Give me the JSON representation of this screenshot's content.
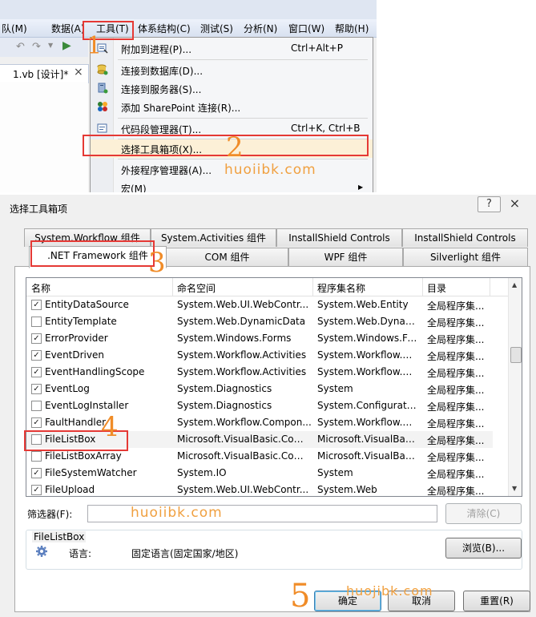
{
  "ide": {
    "menu": [
      "队(M)",
      "数据(A)",
      "工具(T)",
      "体系结构(C)",
      "测试(S)",
      "分析(N)",
      "窗口(W)",
      "帮助(H)"
    ],
    "doc_tab": "1.vb [设计]*",
    "doc_tab_close": "×"
  },
  "tools_menu": {
    "items": [
      {
        "label": "附加到进程(P)...",
        "shortcut": "Ctrl+Alt+P",
        "icon": "attach-process-icon"
      },
      {
        "label": "连接到数据库(D)...",
        "shortcut": "",
        "icon": "database-connect-icon"
      },
      {
        "label": "连接到服务器(S)...",
        "shortcut": "",
        "icon": "server-connect-icon"
      },
      {
        "label": "添加 SharePoint 连接(R)...",
        "shortcut": "",
        "icon": "sharepoint-icon"
      },
      {
        "label": "代码段管理器(T)...",
        "shortcut": "Ctrl+K, Ctrl+B",
        "icon": "snippet-manager-icon"
      },
      {
        "label": "选择工具箱项(X)...",
        "shortcut": "",
        "icon": ""
      },
      {
        "label": "外接程序管理器(A)...",
        "shortcut": "",
        "icon": ""
      },
      {
        "label": "宏(M)",
        "shortcut": "",
        "icon": "submenu-arrow-icon"
      }
    ]
  },
  "annotations": {
    "step1": "1",
    "step2": "2",
    "step3": "3",
    "step4": "4",
    "step5": "5",
    "watermark": "huoiibk.com",
    "watermark2": "huojibk.com",
    "color": "#f08c28",
    "box_color": "#e53935"
  },
  "dialog": {
    "title": "选择工具箱项",
    "help_button": "?",
    "close_button": "×",
    "tabs_row1": [
      "System.Workflow 组件",
      "System.Activities 组件",
      "InstallShield Controls",
      "InstallShield Controls"
    ],
    "tabs_row2": [
      ".NET Framework 组件",
      "COM 组件",
      "WPF 组件",
      "Silverlight 组件"
    ],
    "columns": [
      "名称",
      "命名空间",
      "程序集名称",
      "目录"
    ],
    "rows": [
      {
        "checked": true,
        "name": "EntityDataSource",
        "namespace": "System.Web.UI.WebContr...",
        "assembly": "System.Web.Entity",
        "directory": "全局程序集..."
      },
      {
        "checked": false,
        "name": "EntityTemplate",
        "namespace": "System.Web.DynamicData",
        "assembly": "System.Web.Dynam...",
        "directory": "全局程序集..."
      },
      {
        "checked": true,
        "name": "ErrorProvider",
        "namespace": "System.Windows.Forms",
        "assembly": "System.Windows.Fo...",
        "directory": "全局程序集..."
      },
      {
        "checked": true,
        "name": "EventDriven",
        "namespace": "System.Workflow.Activities",
        "assembly": "System.Workflow.A...",
        "directory": "全局程序集..."
      },
      {
        "checked": true,
        "name": "EventHandlingScope",
        "namespace": "System.Workflow.Activities",
        "assembly": "System.Workflow.A...",
        "directory": "全局程序集..."
      },
      {
        "checked": true,
        "name": "EventLog",
        "namespace": "System.Diagnostics",
        "assembly": "System",
        "directory": "全局程序集..."
      },
      {
        "checked": false,
        "name": "EventLogInstaller",
        "namespace": "System.Diagnostics",
        "assembly": "System.Configuratio...",
        "directory": "全局程序集..."
      },
      {
        "checked": true,
        "name": "FaultHandler",
        "namespace": "System.Workflow.Compon...",
        "assembly": "System.Workflow.C...",
        "directory": "全局程序集..."
      },
      {
        "checked": false,
        "name": "FileListBox",
        "namespace": "Microsoft.VisualBasic.Com...",
        "assembly": "Microsoft.VisualBas...",
        "directory": "全局程序集..."
      },
      {
        "checked": false,
        "name": "FileListBoxArray",
        "namespace": "Microsoft.VisualBasic.Com...",
        "assembly": "Microsoft.VisualBas...",
        "directory": "全局程序集..."
      },
      {
        "checked": true,
        "name": "FileSystemWatcher",
        "namespace": "System.IO",
        "assembly": "System",
        "directory": "全局程序集..."
      },
      {
        "checked": true,
        "name": "FileUpload",
        "namespace": "System.Web.UI.WebContr...",
        "assembly": "System.Web",
        "directory": "全局程序集..."
      }
    ],
    "filter_label": "筛选器(F):",
    "filter_value": "",
    "clear_button": "清除(C)",
    "info_title": "FileListBox",
    "info_language_label": "语言:",
    "info_language_value": "固定语言(固定国家/地区)",
    "browse_button": "浏览(B)...",
    "ok_button": "确定",
    "cancel_button": "取消",
    "reset_button": "重置(R)"
  }
}
